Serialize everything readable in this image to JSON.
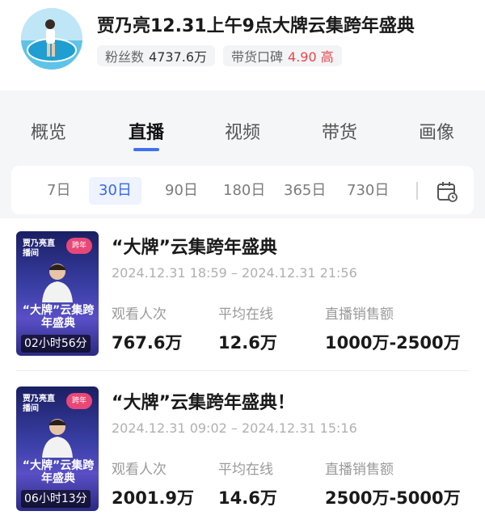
{
  "profile": {
    "name": "贾乃亮12.31上午9点大牌云集跨年盛典",
    "fans_label": "粉丝数",
    "fans_value": "4737.6万",
    "rating_label": "带货口碑",
    "rating_value": "4.90 高",
    "avatar_icon": "person-with-surfboard-avatar"
  },
  "tabs": [
    {
      "label": "概览"
    },
    {
      "label": "直播"
    },
    {
      "label": "视频"
    },
    {
      "label": "带货"
    },
    {
      "label": "画像"
    }
  ],
  "active_tab": "直播",
  "periods": [
    {
      "label": "7日"
    },
    {
      "label": "30日"
    },
    {
      "label": "90日"
    },
    {
      "label": "180日"
    },
    {
      "label": "365日"
    },
    {
      "label": "730日"
    }
  ],
  "active_period": "30日",
  "calendar_icon": "calendar-icon",
  "streams": [
    {
      "thumb_host": "贾乃亮直播间",
      "thumb_logo": "跨年",
      "thumb_title": "“大牌”云集跨年盛典",
      "duration": "02小时56分",
      "title": "“大牌”云集跨年盛典",
      "time": "2024.12.31 18:59 – 2024.12.31 21:56",
      "metrics": [
        {
          "label": "观看人次",
          "value": "767.6万"
        },
        {
          "label": "平均在线",
          "value": "12.6万"
        },
        {
          "label": "直播销售额",
          "value": "1000万-2500万"
        }
      ]
    },
    {
      "thumb_host": "贾乃亮直播间",
      "thumb_logo": "跨年",
      "thumb_title": "“大牌”云集跨年盛典",
      "duration": "06小时13分",
      "title": "“大牌”云集跨年盛典！",
      "time": "2024.12.31 09:02 – 2024.12.31 15:16",
      "metrics": [
        {
          "label": "观看人次",
          "value": "2001.9万"
        },
        {
          "label": "平均在线",
          "value": "14.6万"
        },
        {
          "label": "直播销售额",
          "value": "2500万-5000万"
        }
      ]
    }
  ],
  "colors": {
    "accent": "#3567f0",
    "rating": "#e8464a",
    "thumb_bg": "#3a3fa6"
  }
}
